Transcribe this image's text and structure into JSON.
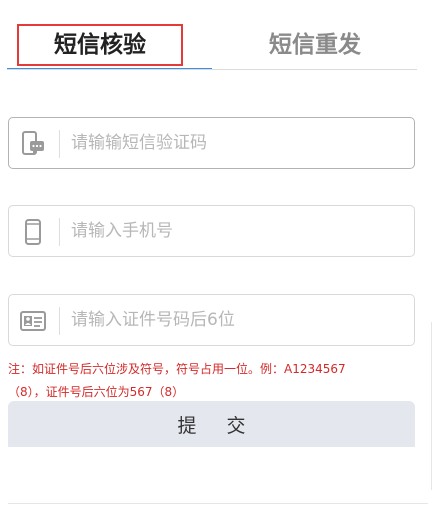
{
  "tabs": {
    "sms_verify": "短信核验",
    "sms_resend": "短信重发"
  },
  "form": {
    "sms_code_placeholder": "请输输短信验证码",
    "phone_placeholder": "请输入手机号",
    "id_placeholder": "请输入证件号码后6位"
  },
  "note": {
    "line1": "注：如证件号后六位涉及符号，符号占用一位。例：A1234567",
    "line2": "（8），证件号后六位为567（8）"
  },
  "submit_label": "提 交",
  "colors": {
    "active_tab_border": "#e53a3a",
    "tab_underline": "#3a8ee6",
    "note_text": "#d42a2a",
    "submit_bg": "#e4e7ee"
  },
  "icons": {
    "sms_code": "phone-message-icon",
    "phone": "mobile-phone-icon",
    "id": "id-card-icon"
  }
}
